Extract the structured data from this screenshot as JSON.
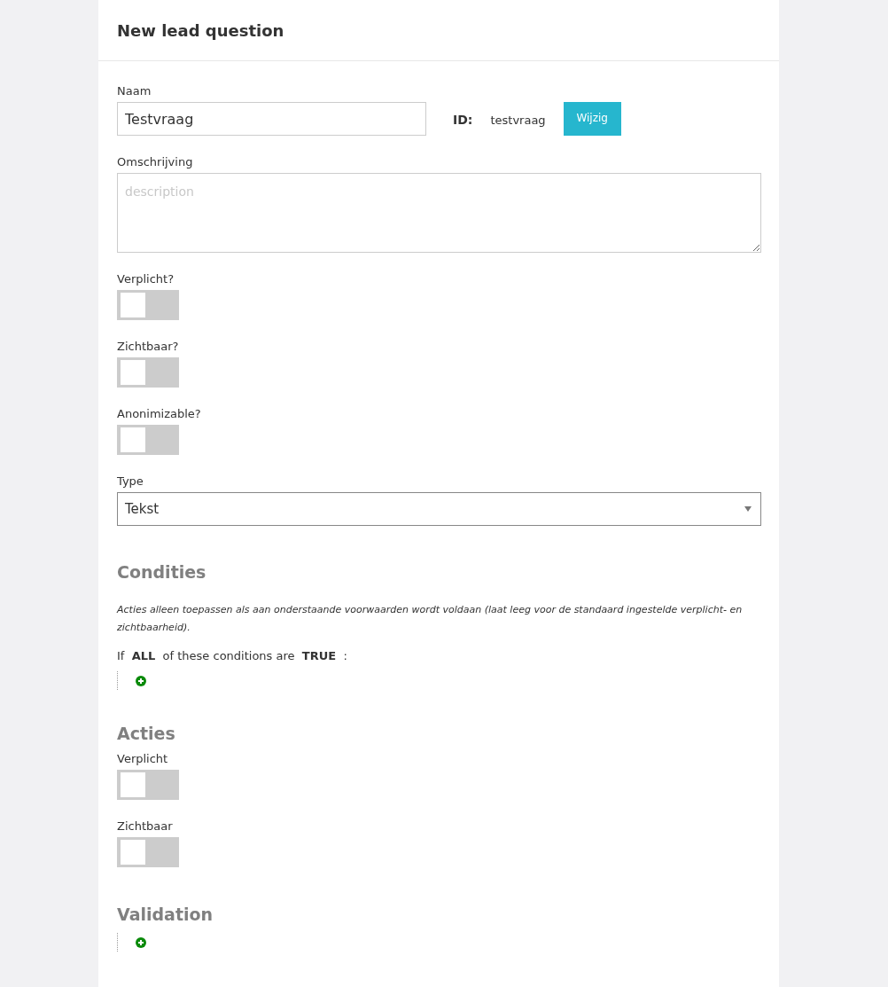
{
  "header": {
    "title": "New lead question"
  },
  "name_field": {
    "label": "Naam",
    "value": "Testvraag"
  },
  "id": {
    "label": "ID:",
    "value": "testvraag",
    "button": "Wijzig"
  },
  "description_field": {
    "label": "Omschrijving",
    "placeholder": "description"
  },
  "toggles": [
    {
      "label": "Verplicht?",
      "on": false
    },
    {
      "label": "Zichtbaar?",
      "on": false
    },
    {
      "label": "Anonimizable?",
      "on": false
    }
  ],
  "type_field": {
    "label": "Type",
    "value": "Tekst"
  },
  "conditions": {
    "heading": "Condities",
    "note": "Acties alleen toepassen als aan onderstaande voorwaarden wordt voldaan (laat leeg voor de standaard ingestelde verplicht- en zichtbaarheid).",
    "rule": "If  **ALL**  of these conditions are  **TRUE**  :"
  },
  "actions": {
    "heading": "Acties",
    "toggles": [
      {
        "label": "Verplicht",
        "on": false
      },
      {
        "label": "Zichtbaar",
        "on": false
      }
    ]
  },
  "validation": {
    "heading": "Validation"
  }
}
